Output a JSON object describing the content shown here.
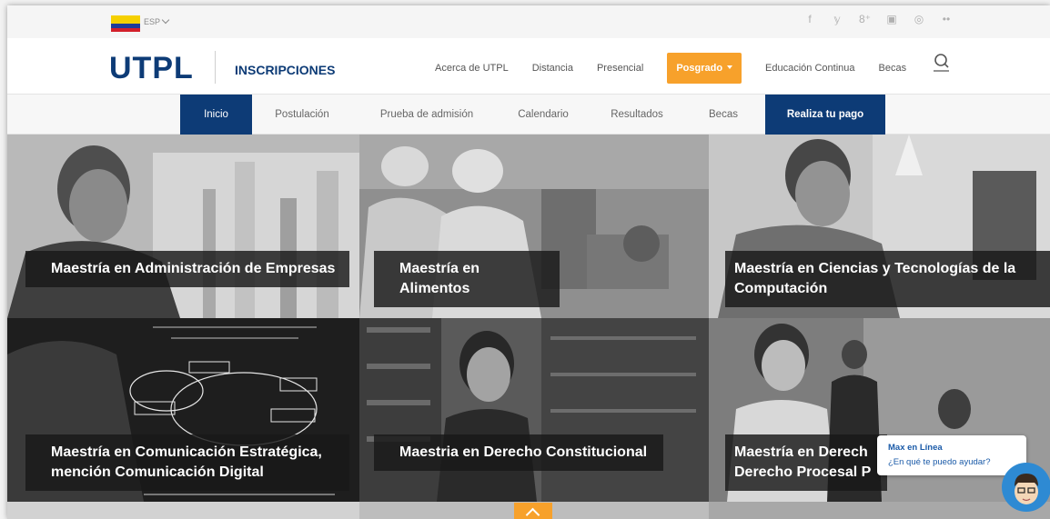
{
  "topbar": {
    "language": "ESP",
    "social": [
      {
        "icon": "facebook-icon",
        "glyph": "f"
      },
      {
        "icon": "twitter-icon",
        "glyph": "𝕪"
      },
      {
        "icon": "google-plus-icon",
        "glyph": "8⁺"
      },
      {
        "icon": "youtube-icon",
        "glyph": "▣"
      },
      {
        "icon": "instagram-icon",
        "glyph": "◎"
      },
      {
        "icon": "flickr-icon",
        "glyph": "••"
      }
    ]
  },
  "header": {
    "logo": "UTPL",
    "section": "INSCRIPCIONES",
    "nav": [
      "Acerca de UTPL",
      "Distancia",
      "Presencial",
      "Posgrado",
      "Educación Continua",
      "Becas"
    ],
    "active_nav": "Posgrado",
    "active_color": "#f7a12b"
  },
  "subnav": {
    "tabs": [
      "Inicio",
      "Postulación",
      "Prueba de admisión",
      "Calendario",
      "Resultados",
      "Becas",
      "Realiza tu pago"
    ],
    "active": "Inicio",
    "highlight_color": "#0d3b76"
  },
  "programs": [
    {
      "line1": "Maestría en Administración de Empresas",
      "line2": ""
    },
    {
      "line1": "Maestría en Alimentos",
      "line2": ""
    },
    {
      "line1": "Maestría en Ciencias y Tecnologías de la",
      "line2": "Computación"
    },
    {
      "line1": "Maestría en Comunicación Estratégica,",
      "line2": "mención Comunicación Digital"
    },
    {
      "line1": "Maestria en Derecho Constitucional",
      "line2": ""
    },
    {
      "line1": "Maestría en Derech",
      "line2": "Derecho Procesal P"
    }
  ],
  "chat": {
    "name": "Max en Línea",
    "message": "¿En qué te puedo ayudar?"
  }
}
